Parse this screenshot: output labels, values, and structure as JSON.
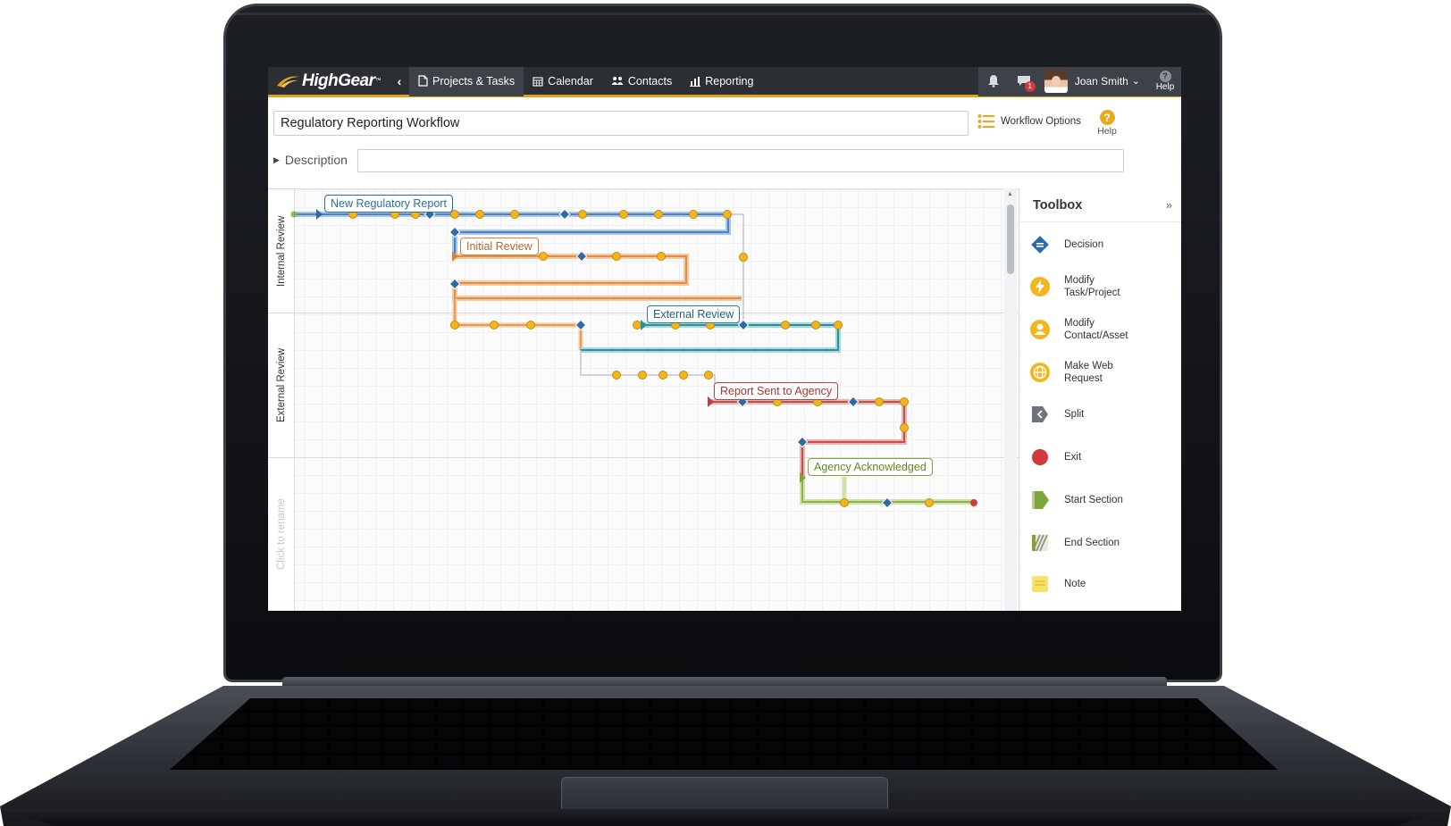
{
  "nav": {
    "logo": "HighGear",
    "logo_tm": "™",
    "items": [
      {
        "label": "Projects & Tasks",
        "icon": "document-icon"
      },
      {
        "label": "Calendar",
        "icon": "calendar-icon"
      },
      {
        "label": "Contacts",
        "icon": "contacts-icon"
      },
      {
        "label": "Reporting",
        "icon": "bar-chart-icon"
      }
    ],
    "message_count": "1",
    "user_name": "Joan Smith",
    "help_label": "Help"
  },
  "workflow": {
    "title": "Regulatory Reporting Workflow",
    "options_label": "Workflow Options",
    "help_label": "Help",
    "description_label": "Description",
    "description_value": ""
  },
  "lanes": [
    {
      "label": "Internal Review",
      "muted": false
    },
    {
      "label": "External Review",
      "muted": false
    },
    {
      "label": "Click to rename",
      "muted": true
    }
  ],
  "sections": [
    {
      "label": "New Regulatory Report",
      "color": "#2e6aa8"
    },
    {
      "label": "Initial Review",
      "color": "#d9813a"
    },
    {
      "label": "External Review",
      "color": "#2a7f8f"
    },
    {
      "label": "Report Sent to Agency",
      "color": "#b8433f"
    },
    {
      "label": "Agency Acknowledged",
      "color": "#7fa53a"
    }
  ],
  "toolbox": {
    "title": "Toolbox",
    "collapse_glyph": "»",
    "items": [
      {
        "label": "Decision",
        "icon": "decision-icon"
      },
      {
        "label": "Modify Task/Project",
        "icon": "lightning-icon"
      },
      {
        "label": "Modify Contact/Asset",
        "icon": "person-icon"
      },
      {
        "label": "Make Web Request",
        "icon": "globe-icon"
      },
      {
        "label": "Split",
        "icon": "split-icon"
      },
      {
        "label": "Exit",
        "icon": "exit-icon"
      },
      {
        "label": "Start Section",
        "icon": "start-section-icon"
      },
      {
        "label": "End Section",
        "icon": "end-section-icon"
      },
      {
        "label": "Note",
        "icon": "note-icon"
      }
    ]
  },
  "colors": {
    "accent": "#e0a31a",
    "nav_bg": "#2b2e33",
    "node_gold": "#f2b51c",
    "decision_blue": "#2e6aa8"
  }
}
